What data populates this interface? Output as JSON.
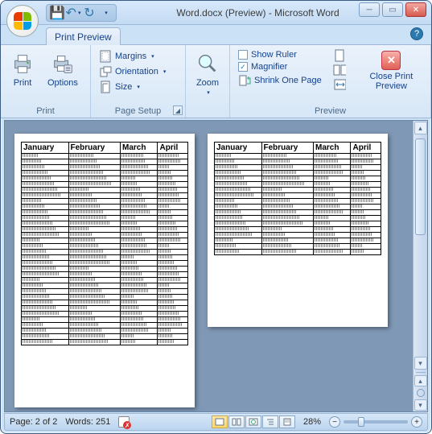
{
  "window": {
    "title": "Word.docx (Preview) - Microsoft Word"
  },
  "qat": {
    "save": "save-icon",
    "undo": "undo-icon",
    "redo": "redo-icon"
  },
  "tab": {
    "label": "Print Preview"
  },
  "ribbon": {
    "print_group": {
      "title": "Print",
      "print": "Print",
      "options": "Options"
    },
    "page_setup_group": {
      "title": "Page Setup",
      "margins": "Margins",
      "orientation": "Orientation",
      "size": "Size"
    },
    "zoom_group": {
      "title": "",
      "zoom": "Zoom"
    },
    "preview_group": {
      "title": "Preview",
      "show_ruler": "Show Ruler",
      "show_ruler_checked": false,
      "magnifier": "Magnifier",
      "magnifier_checked": true,
      "shrink": "Shrink One Page",
      "close": "Close Print Preview"
    }
  },
  "document": {
    "table_headers": [
      "January",
      "February",
      "March",
      "April"
    ],
    "page1_rows": 34,
    "page2_rows": 18
  },
  "statusbar": {
    "page": "Page: 2 of 2",
    "words": "Words: 251",
    "zoom_pct": "28%"
  }
}
